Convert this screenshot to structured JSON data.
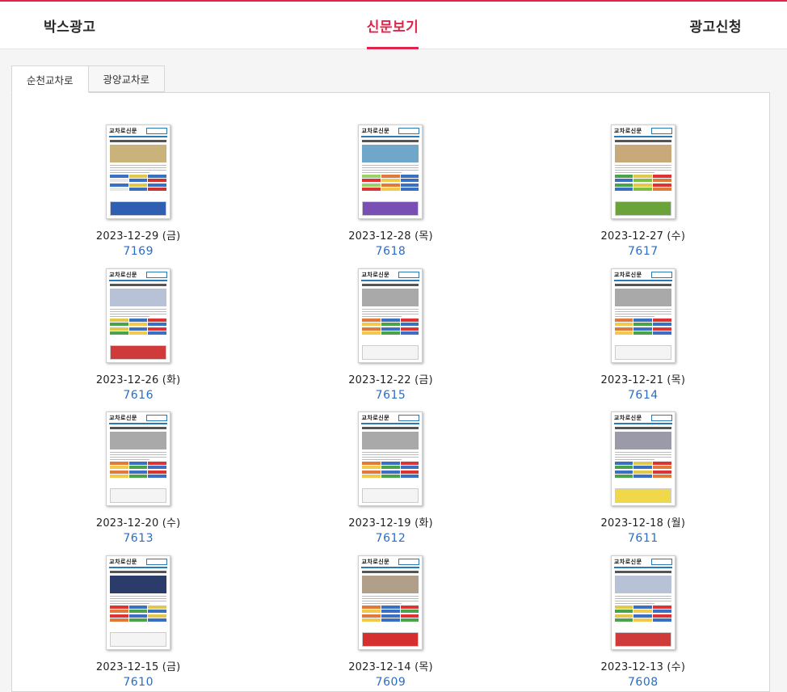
{
  "nav": {
    "items": [
      {
        "label": "박스광고",
        "active": false
      },
      {
        "label": "신문보기",
        "active": true
      },
      {
        "label": "광고신청",
        "active": false
      }
    ]
  },
  "tabs": [
    {
      "label": "순천교차로",
      "active": true
    },
    {
      "label": "광양교차로",
      "active": false
    }
  ],
  "masthead": "교차로신문",
  "issues": [
    {
      "date": "2023-12-29 (금)",
      "number": "7169",
      "variant": "a"
    },
    {
      "date": "2023-12-28 (목)",
      "number": "7618",
      "variant": "b"
    },
    {
      "date": "2023-12-27 (수)",
      "number": "7617",
      "variant": "c"
    },
    {
      "date": "2023-12-26 (화)",
      "number": "7616",
      "variant": "d"
    },
    {
      "date": "2023-12-22 (금)",
      "number": "7615",
      "variant": "e"
    },
    {
      "date": "2023-12-21 (목)",
      "number": "7614",
      "variant": "e"
    },
    {
      "date": "2023-12-20 (수)",
      "number": "7613",
      "variant": "e"
    },
    {
      "date": "2023-12-19 (화)",
      "number": "7612",
      "variant": "e"
    },
    {
      "date": "2023-12-18 (월)",
      "number": "7611",
      "variant": "f"
    },
    {
      "date": "2023-12-15 (금)",
      "number": "7610",
      "variant": "g"
    },
    {
      "date": "2023-12-14 (목)",
      "number": "7609",
      "variant": "h"
    },
    {
      "date": "2023-12-13 (수)",
      "number": "7608",
      "variant": "d"
    }
  ],
  "colors": {
    "accent": "#e0254a",
    "link": "#2b6cc4",
    "masthead_rule": "#2a7ab8"
  }
}
